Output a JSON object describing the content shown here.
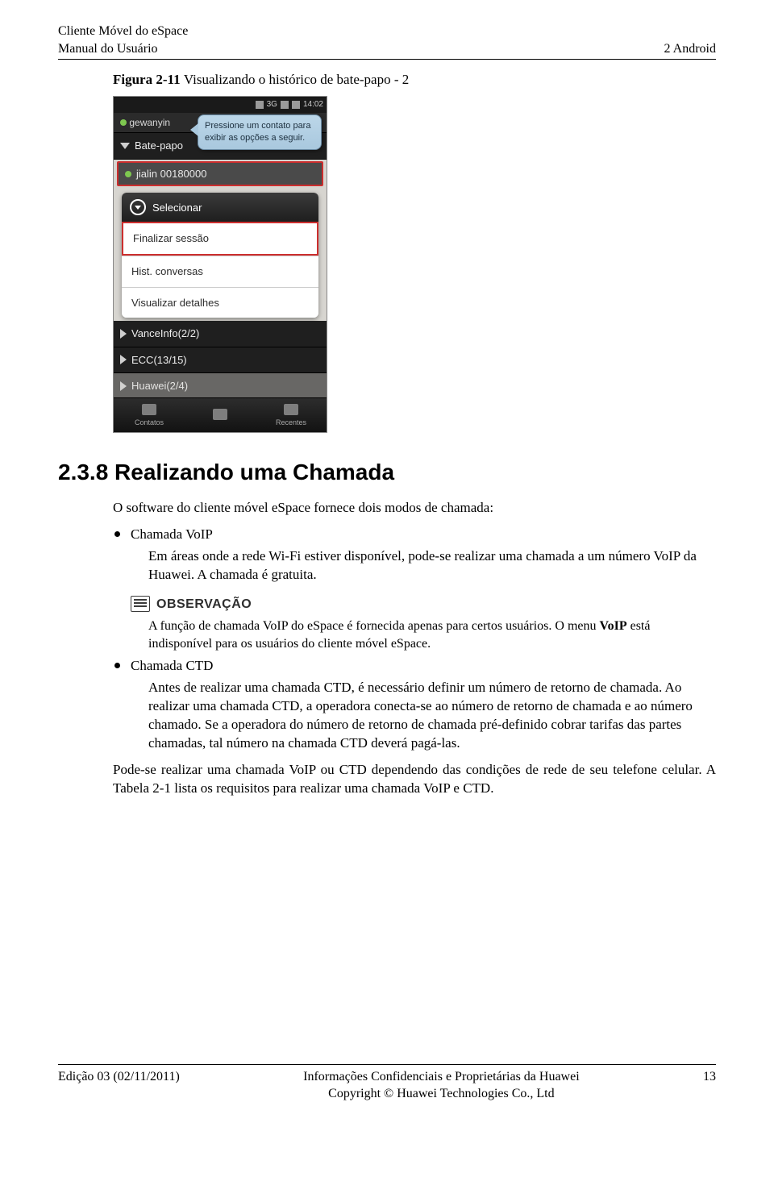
{
  "header": {
    "left1": "Cliente Móvel do eSpace",
    "left2": "Manual do Usuário",
    "right": "2 Android"
  },
  "figure": {
    "label": "Figura 2-11",
    "caption": "Visualizando o histórico de bate-papo - 2"
  },
  "phone": {
    "time": "14:02",
    "signal": "3G",
    "gew_row": "gewanyin",
    "bate_row": "Bate-papo",
    "jialin": "jialin 00180000",
    "tooltip": "Pressione um contato para exibir as opções a seguir.",
    "menu": {
      "selecionar": "Selecionar",
      "finalizar": "Finalizar sessão",
      "hist": "Hist. conversas",
      "visual": "Visualizar detalhes"
    },
    "group1": "VanceInfo(2/2)",
    "group2": "ECC(13/15)",
    "group3": "Huawei(2/4)",
    "bottom": {
      "contatos": "Contatos",
      "mid": "",
      "recentes": "Recentes"
    }
  },
  "section": {
    "title": "2.3.8 Realizando uma Chamada",
    "intro": "O software do cliente móvel eSpace fornece dois modos de chamada:",
    "voip_label": "Chamada VoIP",
    "voip_text": "Em áreas onde a rede Wi-Fi estiver disponível, pode-se realizar uma chamada a um número VoIP da Huawei. A chamada é gratuita.",
    "obs": "OBSERVAÇÃO",
    "note_pre": "A função de chamada VoIP do eSpace é fornecida apenas para certos usuários. O menu ",
    "note_bold": "VoIP",
    "note_post": " está indisponível para os usuários do cliente móvel eSpace.",
    "ctd_label": "Chamada CTD",
    "ctd_text": "Antes de realizar uma chamada CTD, é necessário definir um número de retorno de chamada. Ao realizar uma chamada CTD, a operadora conecta-se ao número de retorno de chamada e ao número chamado. Se a operadora do número de retorno de chamada pré-definido cobrar tarifas das partes chamadas, tal número na chamada CTD deverá pagá-las.",
    "closing": "Pode-se realizar uma chamada VoIP ou CTD dependendo das condições de rede de seu telefone celular. A Tabela 2-1 lista os requisitos para realizar uma chamada VoIP e CTD."
  },
  "footer": {
    "left": "Edição 03 (02/11/2011)",
    "center1": "Informações Confidenciais e Proprietárias da Huawei",
    "center2": "Copyright © Huawei Technologies Co., Ltd",
    "right": "13"
  }
}
